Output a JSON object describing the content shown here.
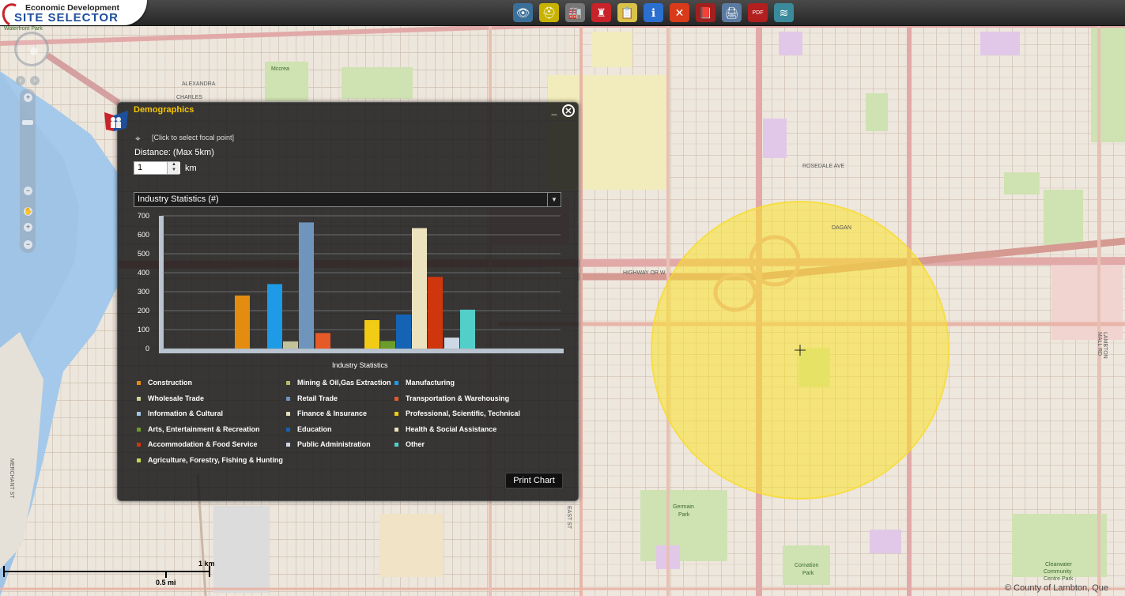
{
  "app": {
    "logo_line1": "Economic Development",
    "logo_line2": "SITE SELECTOR"
  },
  "toolbar": {
    "tools": [
      {
        "name": "binoculars-icon",
        "glyph": "👁",
        "color": "#3a6f9a"
      },
      {
        "name": "hard-hat-icon",
        "glyph": "⛑",
        "color": "#c7b200"
      },
      {
        "name": "factory-icon",
        "glyph": "🏭",
        "color": "#777"
      },
      {
        "name": "demographics-icon",
        "glyph": "♜",
        "color": "#c8232a"
      },
      {
        "name": "report-icon",
        "glyph": "📋",
        "color": "#d8c24a"
      },
      {
        "name": "info-icon",
        "glyph": "ℹ",
        "color": "#2a6fd0"
      },
      {
        "name": "measure-icon",
        "glyph": "✕",
        "color": "#d83a1a"
      },
      {
        "name": "bookmark-icon",
        "glyph": "📕",
        "color": "#a02020"
      },
      {
        "name": "print-icon",
        "glyph": "🖨",
        "color": "#5a7aa0"
      },
      {
        "name": "pdf-icon",
        "glyph": "PDF",
        "color": "#b21f1f"
      },
      {
        "name": "layers-icon",
        "glyph": "≋",
        "color": "#3a8a9c"
      }
    ]
  },
  "map_labels": {
    "waterfront_park": "Waterfront Park",
    "mccrea": "Mccrea",
    "alexandra": "ALEXANDRA",
    "charles": "CHARLES",
    "rosedale": "ROSEDALE AVE",
    "highway": "HIGHWAY OR W",
    "dagan": "DAGAN",
    "germain": "Germain",
    "germain_park": "Park",
    "cornation": "Cornation",
    "cornation_park": "Park",
    "clearwater1": "Clearwater",
    "clearwater2": "Community",
    "clearwater3": "Centre Park",
    "hwy_st": "EXMOUTH ST",
    "east_st": "EAST ST",
    "mervinia_st": "MERCHANT ST",
    "lambton_mall": "LAMBTON MALL RD"
  },
  "scale": {
    "km_label": "1 km",
    "mi_label": "0.5 mi"
  },
  "copyright": "© County of Lambton, Que",
  "panel": {
    "title": "Demographics",
    "minimize": "_",
    "close": "✕",
    "focal_text": "[Click to select focal point]",
    "distance_label": "Distance: (Max 5km)",
    "distance_value": "1",
    "distance_unit": "km",
    "stat_select": "Industry Statistics (#)",
    "print_button": "Print Chart"
  },
  "chart_data": {
    "type": "bar",
    "xlabel": "Industry Statistics",
    "ylabel": "",
    "ylim": [
      0,
      700
    ],
    "yticks": [
      0,
      100,
      200,
      300,
      400,
      500,
      600,
      700
    ],
    "grid": true,
    "series": [
      {
        "name": "Construction",
        "value": 280,
        "color": "#e38c10"
      },
      {
        "name": "Manufacturing",
        "value": 340,
        "color": "#1e9be6"
      },
      {
        "name": "Mining & Oil,Gas Extraction",
        "value": 38,
        "color": "#c3c39a"
      },
      {
        "name": "Retail Trade",
        "value": 665,
        "color": "#6f95bd"
      },
      {
        "name": "Transportation & Warehousing",
        "value": 82,
        "color": "#e65a28"
      },
      {
        "name": "Professional, Scientific, Technical",
        "value": 150,
        "color": "#f2cc14"
      },
      {
        "name": "Arts, Entertainment & Recreation",
        "value": 40,
        "color": "#6c9c2a"
      },
      {
        "name": "Education",
        "value": 180,
        "color": "#1463b4"
      },
      {
        "name": "Health & Social Assistance",
        "value": 635,
        "color": "#ede2be"
      },
      {
        "name": "Accommodation & Food Service",
        "value": 378,
        "color": "#d0360e"
      },
      {
        "name": "Public Administration",
        "value": 58,
        "color": "#cdd7e6"
      },
      {
        "name": "Other",
        "value": 205,
        "color": "#53cfc9"
      }
    ]
  },
  "legend": [
    {
      "label": "Construction",
      "color": "#e38c10"
    },
    {
      "label": "Mining & Oil,Gas Extraction",
      "color": "#b6b86c"
    },
    {
      "label": "Manufacturing",
      "color": "#1e9be6"
    },
    {
      "label": "Wholesale Trade",
      "color": "#cfd29a"
    },
    {
      "label": "Retail Trade",
      "color": "#6f95bd"
    },
    {
      "label": "Transportation & Warehousing",
      "color": "#e65a28"
    },
    {
      "label": "Information & Cultural",
      "color": "#9fc5e8"
    },
    {
      "label": "Finance & Insurance",
      "color": "#e8dfb8"
    },
    {
      "label": "Professional, Scientific, Technical",
      "color": "#f2cc14"
    },
    {
      "label": "Arts, Entertainment & Recreation",
      "color": "#6c9c2a"
    },
    {
      "label": "Education",
      "color": "#1463b4"
    },
    {
      "label": "Health & Social Assistance",
      "color": "#ede2be"
    },
    {
      "label": "Accommodation & Food Service",
      "color": "#d0360e"
    },
    {
      "label": "Public Administration",
      "color": "#cdd7e6"
    },
    {
      "label": "Other",
      "color": "#53cfc9"
    },
    {
      "label": "Agriculture, Forestry, Fishing & Hunting",
      "color": "#c8d84a"
    }
  ]
}
